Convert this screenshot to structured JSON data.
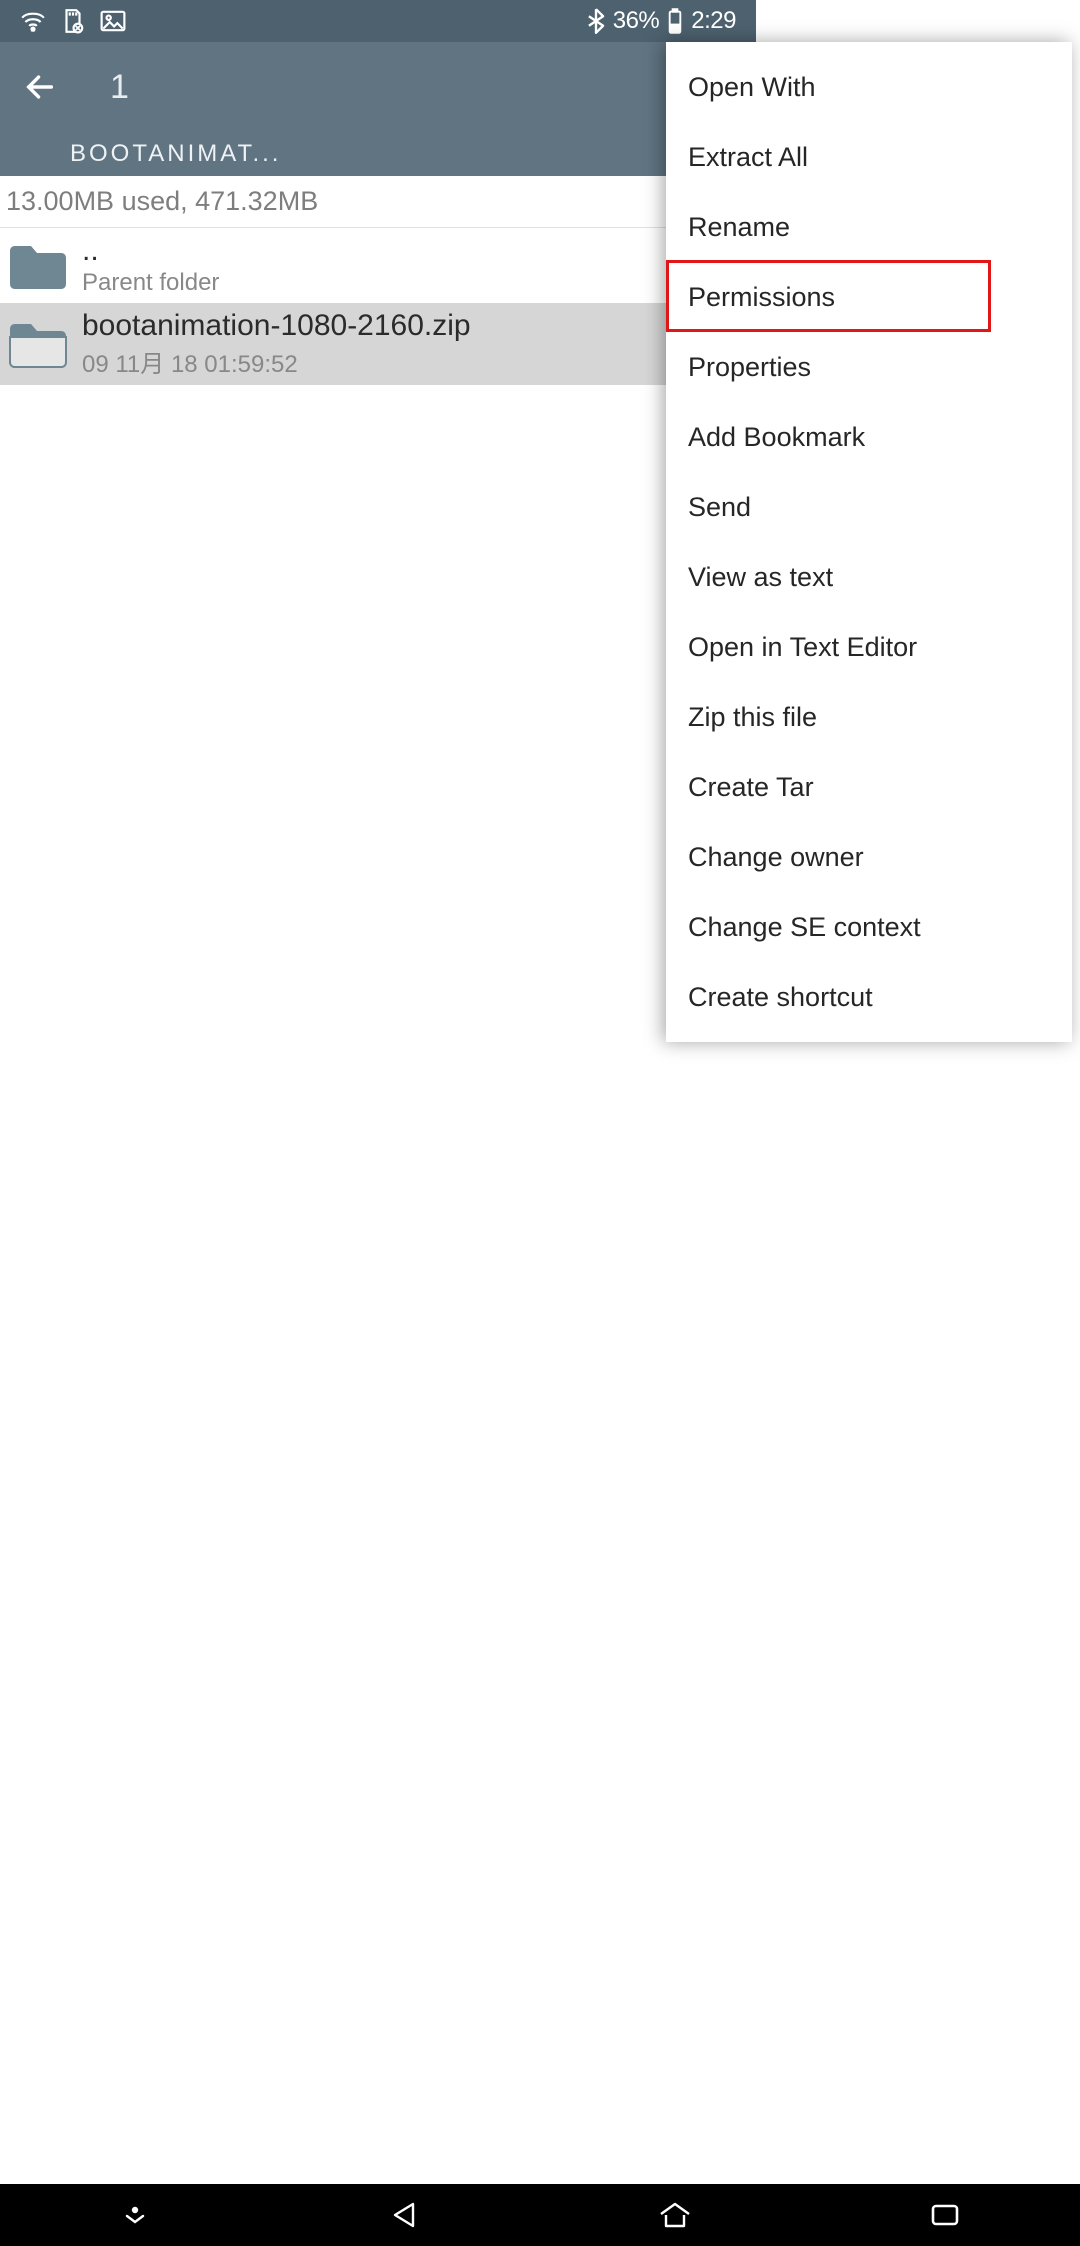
{
  "status": {
    "battery_pct": "36%",
    "time": "2:29"
  },
  "appbar": {
    "selection_count": "1",
    "path_crumb": "BOOTANIMAT..."
  },
  "storage": {
    "line": "13.00MB used, 471.32MB"
  },
  "files": {
    "parent": {
      "name": "..",
      "sub": "Parent folder"
    },
    "item1": {
      "name": "bootanimation-1080-2160.zip",
      "sub": "09 11月 18 01:59:52"
    }
  },
  "menu": {
    "items": [
      "Open With",
      "Extract All",
      "Rename",
      "Permissions",
      "Properties",
      "Add Bookmark",
      "Send",
      "View as text",
      "Open in Text Editor",
      "Zip this file",
      "Create Tar",
      "Change owner",
      "Change SE context",
      "Create shortcut"
    ],
    "highlighted_index": 3
  }
}
